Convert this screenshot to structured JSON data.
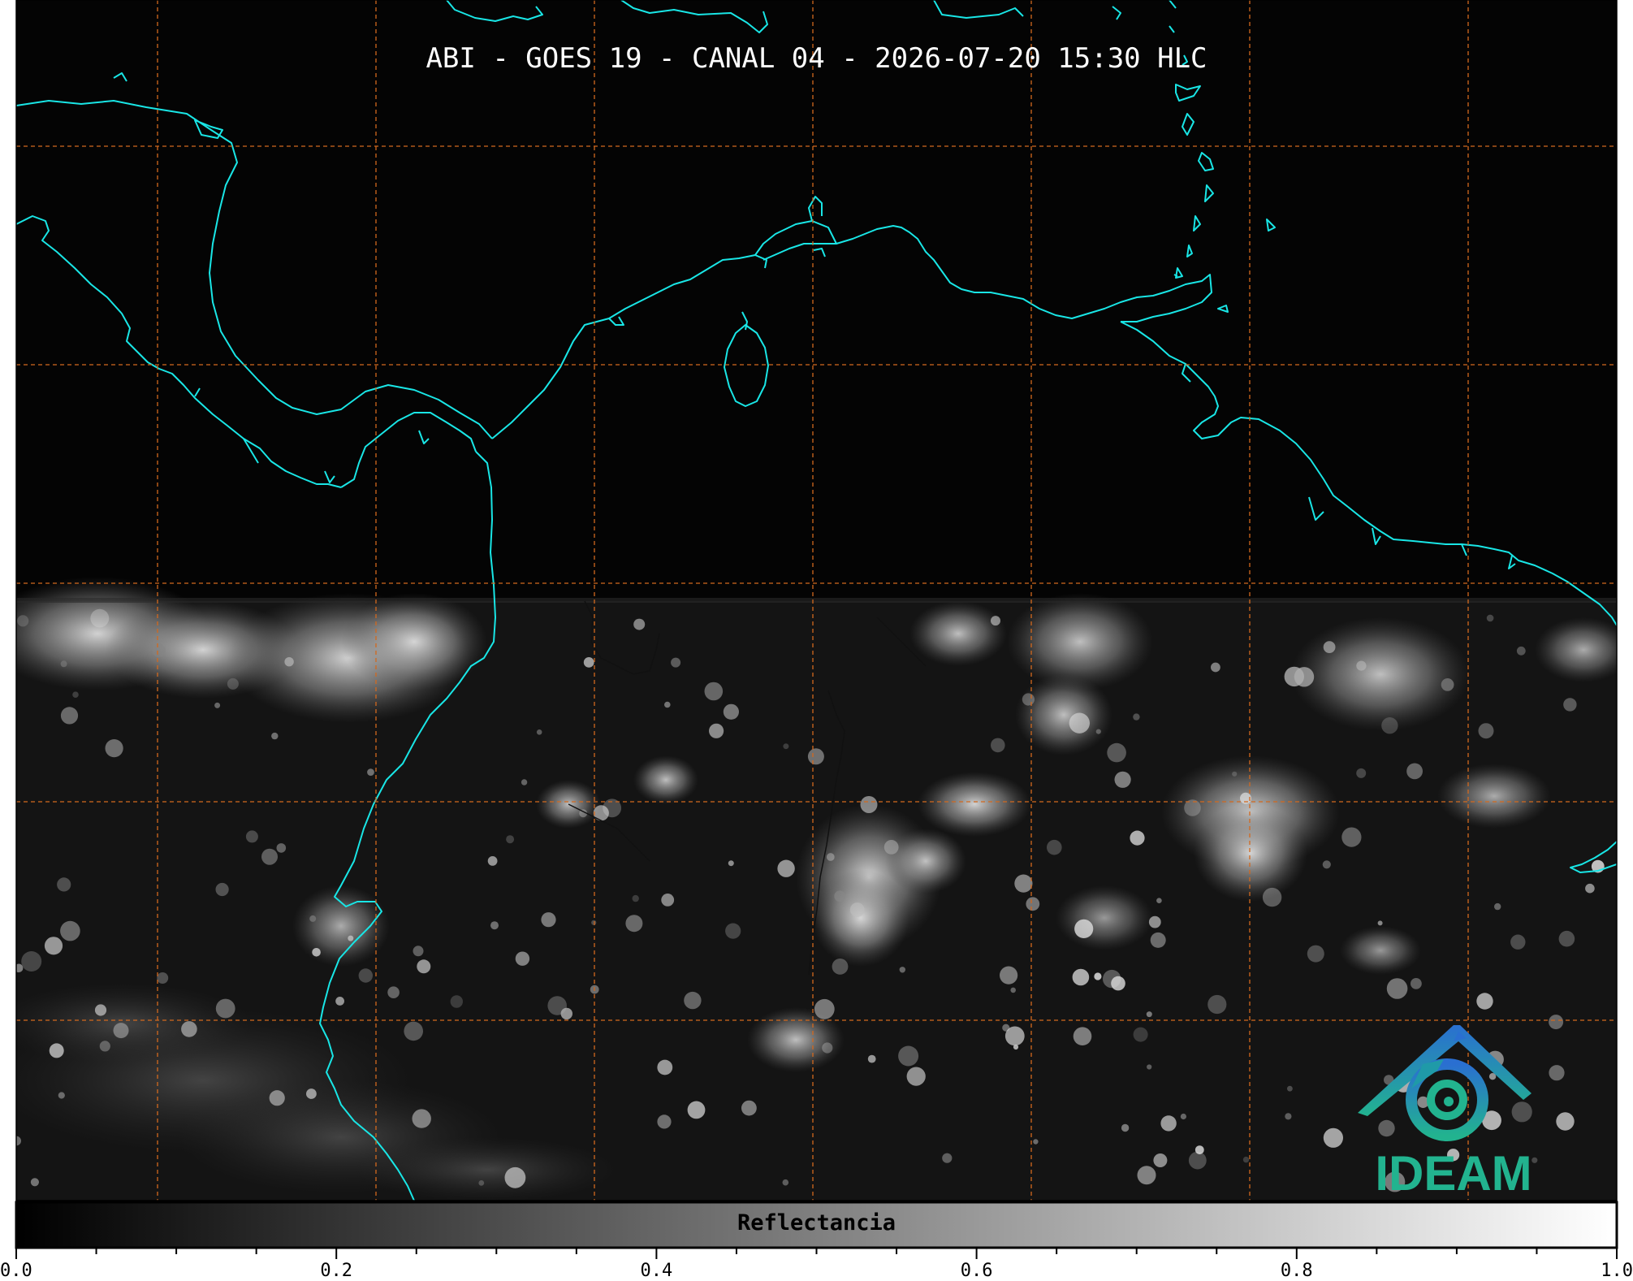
{
  "title": "ABI - GOES 19 - CANAL 04 - 2026-07-20 15:30 HLC",
  "logo": {
    "text": "IDEAM",
    "text_color": "#22b38f",
    "icon_name": "ideam-logo-icon"
  },
  "colors": {
    "background": "#040404",
    "coastline": "#19e6e6",
    "grid": "#d2691e",
    "border": "#111111"
  },
  "colorbar": {
    "label": "Reflectancia",
    "range": [
      0.0,
      1.0
    ],
    "cmap": "gray",
    "tick_labels": [
      "0.0",
      "0.2",
      "0.4",
      "0.6",
      "0.8",
      "1.0"
    ],
    "tick_values": [
      0.0,
      0.2,
      0.4,
      0.6,
      0.8,
      1.0
    ],
    "minor_tick_step": 0.05
  }
}
